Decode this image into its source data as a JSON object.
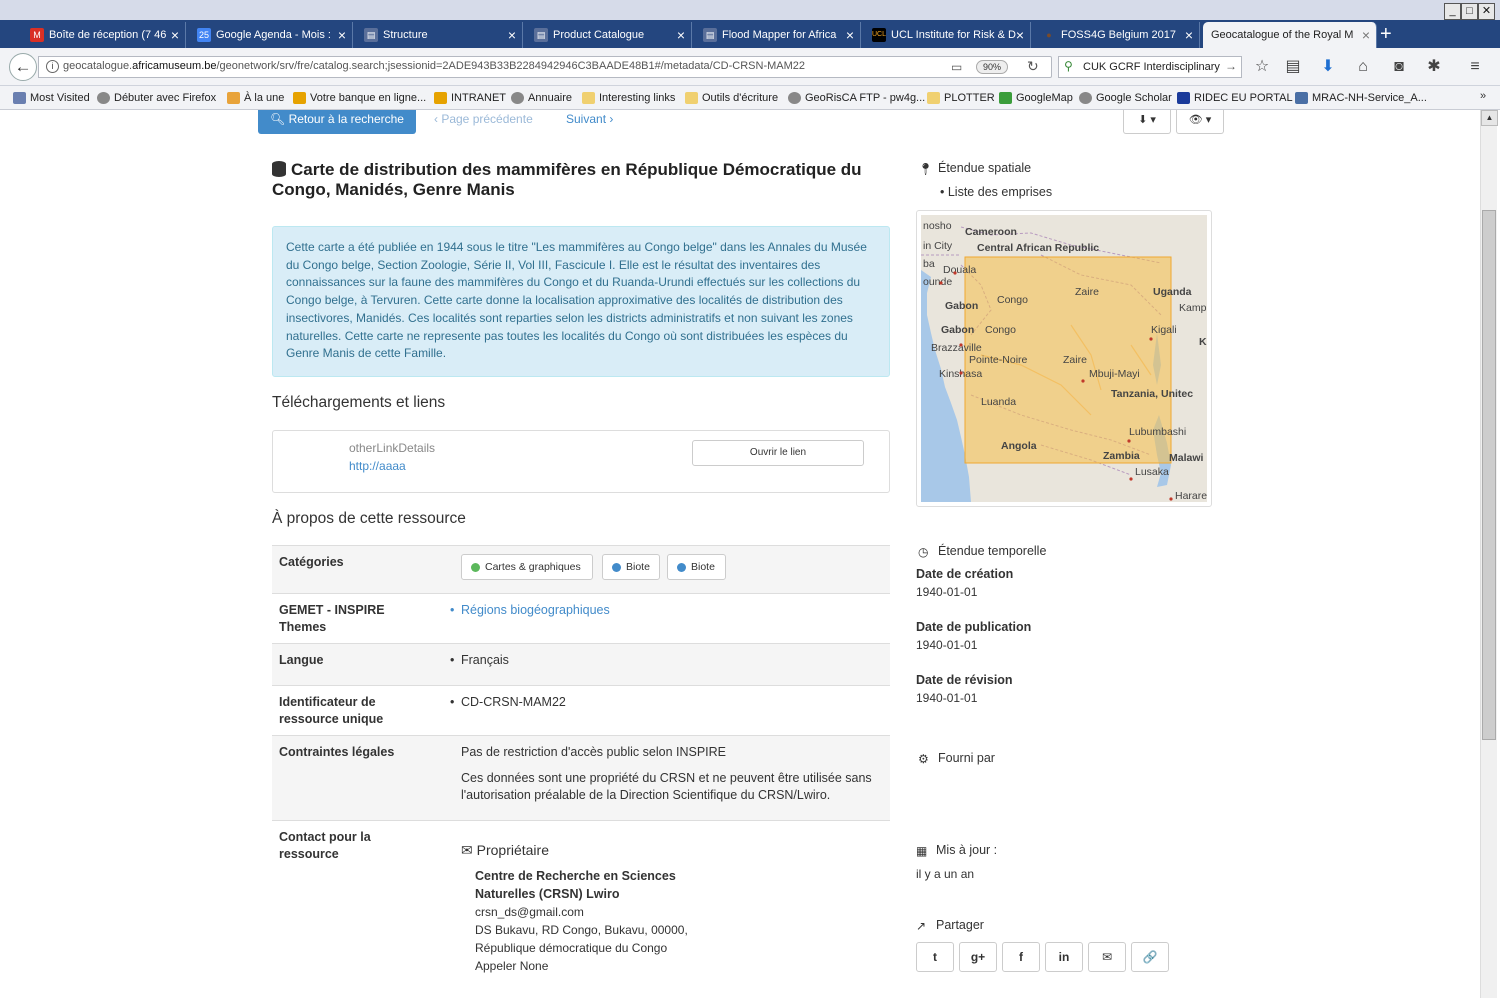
{
  "browser": {
    "window_controls": [
      "_",
      "□",
      "✕"
    ],
    "tabs": [
      {
        "label": "Boîte de réception (7 46",
        "icon": "gmail-icon",
        "color": "#d93025",
        "glyph": "M"
      },
      {
        "label": "Google Agenda - Mois :",
        "icon": "calendar-icon",
        "color": "#4285f4",
        "glyph": "25"
      },
      {
        "label": "Structure",
        "icon": "page-icon",
        "color": "#5a6f9a",
        "glyph": "▤"
      },
      {
        "label": "Product Catalogue",
        "icon": "page-icon",
        "color": "#5a6f9a",
        "glyph": "▤"
      },
      {
        "label": "Flood Mapper for Africa",
        "icon": "page-icon",
        "color": "#5a6f9a",
        "glyph": "▤"
      },
      {
        "label": "UCL Institute for Risk & D",
        "icon": "ucl-icon",
        "color": "#000000",
        "glyph": "UCL"
      },
      {
        "label": "FOSS4G Belgium 2017",
        "icon": "foss4g-icon",
        "color": "#7a4b2a",
        "glyph": "●"
      },
      {
        "label": "Geocatalogue of the Royal M",
        "icon": "page-icon",
        "color": "#888888",
        "glyph": ""
      }
    ],
    "new_tab": "+",
    "url_domain": "geocatalogue.",
    "url_host": "africamuseum.be",
    "url_path": "/geonetwork/srv/fre/catalog.search;jsessionid=2ADE943B33B2284942946C3BAADE48B1#/metadata/CD-CRSN-MAM22",
    "zoom": "90%",
    "search_value": "CUK GCRF Interdisciplinary Re",
    "bookmarks": [
      {
        "label": "Most Visited",
        "color": "#6a7fb0"
      },
      {
        "label": "Débuter avec Firefox",
        "color": "#888"
      },
      {
        "label": "À la une",
        "color": "#e8a33a"
      },
      {
        "label": "Votre banque en ligne...",
        "color": "#e6a200"
      },
      {
        "label": "INTRANET",
        "color": "#e6a200"
      },
      {
        "label": "Annuaire",
        "color": "#888"
      },
      {
        "label": "Interesting links",
        "color": "#f0d070"
      },
      {
        "label": "Outils d'écriture",
        "color": "#f0d070"
      },
      {
        "label": "GeoRisCA FTP - pw4g...",
        "color": "#888"
      },
      {
        "label": "PLOTTER",
        "color": "#f0d070"
      },
      {
        "label": "GoogleMap",
        "color": "#3b9d3b"
      },
      {
        "label": "Google Scholar",
        "color": "#888"
      },
      {
        "label": "RIDEC EU PORTAL",
        "color": "#1a3a9a"
      },
      {
        "label": "MRAC-NH-Service_A...",
        "color": "#4a6fa5"
      }
    ],
    "bookmarks_more": "»"
  },
  "page": {
    "back_to_search": "Retour à la recherche",
    "prev_page": "‹ Page précédente",
    "next_page": "Suivant ›",
    "download_btn": "⬇ ▾",
    "view_btn": "👁 ▾",
    "title": "Carte de distribution des mammifères en République Démocratique du Congo, Manidés, Genre Manis",
    "abstract": "Cette carte a été publiée en 1944 sous le titre \"Les mammifères au Congo belge\" dans les Annales du Musée du Congo belge, Section Zoologie, Série II, Vol III, Fascicule I. Elle est le résultat des inventaires des connaissances sur la faune des mammifères du Congo et du Ruanda-Urundi effectués sur les collections du Congo belge, à Tervuren. Cette carte donne la localisation approximative des localités de distribution des insectivores, Manidés. Ces localités sont reparties selon les districts administratifs et non suivant les zones naturelles. Cette carte ne represente pas toutes les localités du Congo où sont distribuées les espèces du Genre Manis de cette Famille.",
    "downloads_heading": "Téléchargements et liens",
    "link_details": "otherLinkDetails",
    "link_url": "http://aaaa",
    "open_link": "Ouvrir le lien",
    "about_heading": "À propos de cette ressource",
    "categories_label": "Catégories",
    "category_tags": [
      {
        "label": "Cartes & graphiques",
        "color": "#5cb85c"
      },
      {
        "label": "Biote",
        "color": "#428bca"
      },
      {
        "label": "Biote",
        "color": "#428bca"
      }
    ],
    "gemet_label": "GEMET - INSPIRE Themes",
    "gemet_value": "Régions biogéographiques",
    "language_label": "Langue",
    "language_value": "Français",
    "identifier_label": "Identificateur de ressource unique",
    "identifier_value": "CD-CRSN-MAM22",
    "constraints_label": "Contraintes légales",
    "constraints_1": "Pas de restriction d'accès public selon INSPIRE",
    "constraints_2a": "Ces données sont une propriété du CRSN et ne peuvent être utilisée sans",
    "constraints_2b": "l'autorisation préalable de la Direction Scientifique du CRSN/Lwiro.",
    "contact_label": "Contact pour la ressource",
    "contact_role": "Propriétaire",
    "contact_org": "Centre de Recherche en Sciences Naturelles (CRSN) Lwiro",
    "contact_email": "crsn_ds@gmail.com",
    "contact_address": "DS Bukavu, RD Congo, Bukavu, 00000,",
    "contact_country": "République démocratique du Congo",
    "contact_call": "Appeler None"
  },
  "sidebar": {
    "spatial_heading": "Étendue spatiale",
    "extents_item": "Liste des emprises",
    "map_labels": {
      "nosho": "nosho",
      "cameroon": "Cameroon",
      "car": "Central African Republic",
      "city": "in City",
      "ba": "ba",
      "douala": "Douala",
      "ounde": "ounde",
      "zaire1": "Zaire",
      "uganda": "Uganda",
      "gabon1": "Gabon",
      "congo1": "Congo",
      "kamp": "Kamp",
      "kigali": "Kigali",
      "gabon2": "Gabon",
      "congo2": "Congo",
      "brazzaville": "Brazzaville",
      "pointe": "Pointe-Noire",
      "zaire2": "Zaire",
      "k": "K",
      "kinshasa": "Kinshasa",
      "mbuji": "Mbuji-Mayi",
      "tanzania": "Tanzania, Unitec",
      "luanda": "Luanda",
      "lubumbashi": "Lubumbashi",
      "angola": "Angola",
      "zambia": "Zambia",
      "malawi": "Malawi",
      "lusaka": "Lusaka",
      "harare": "Harare"
    },
    "temporal_heading": "Étendue temporelle",
    "creation_label": "Date de création",
    "creation_value": "1940-01-01",
    "publication_label": "Date de publication",
    "publication_value": "1940-01-01",
    "revision_label": "Date de révision",
    "revision_value": "1940-01-01",
    "provided_heading": "Fourni par",
    "updated_heading": "Mis à jour :",
    "updated_value": "il y a un an",
    "share_heading": "Partager",
    "share_buttons": [
      "t",
      "g+",
      "f",
      "in",
      "✉",
      "🔗"
    ]
  }
}
